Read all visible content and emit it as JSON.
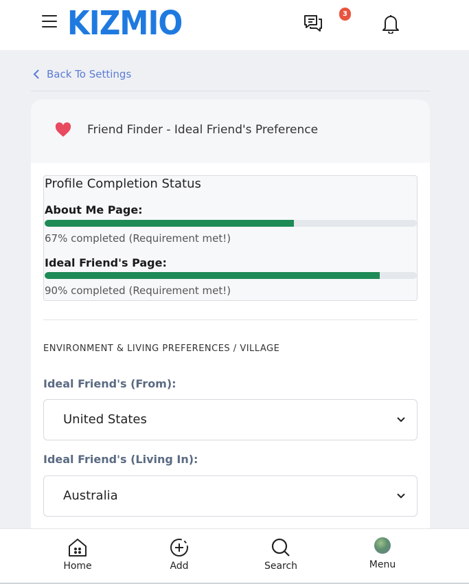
{
  "header": {
    "logo": "KIZMIO",
    "notification_count": "3",
    "icons": [
      "hamburger-icon",
      "chat-icon",
      "bell-icon"
    ]
  },
  "back_link": {
    "label": "Back To Settings"
  },
  "card": {
    "title": "Friend Finder - Ideal Friend's Preference",
    "status": {
      "title": "Profile Completion Status",
      "items": [
        {
          "label": "About Me Page:",
          "percent": 67,
          "text": "67% completed (Requirement met!)"
        },
        {
          "label": "Ideal Friend's Page:",
          "percent": 90,
          "text": "90% completed (Requirement met!)"
        }
      ]
    },
    "section_heading": "ENVIRONMENT & LIVING PREFERENCES / VILLAGE",
    "fields": [
      {
        "label": "Ideal Friend's (From):",
        "value": "United States"
      },
      {
        "label": "Ideal Friend's (Living In):",
        "value": "Australia"
      }
    ]
  },
  "bottom_nav": {
    "items": [
      {
        "label": "Home",
        "icon": "home-icon"
      },
      {
        "label": "Add",
        "icon": "add-circle-icon"
      },
      {
        "label": "Search",
        "icon": "search-icon"
      },
      {
        "label": "Menu",
        "icon": "avatar"
      }
    ]
  },
  "colors": {
    "brand": "#1f7ae0",
    "progress": "#1e8a56",
    "badge": "#e8553f",
    "link": "#5b7bd5",
    "heart": "#e84a5f"
  }
}
